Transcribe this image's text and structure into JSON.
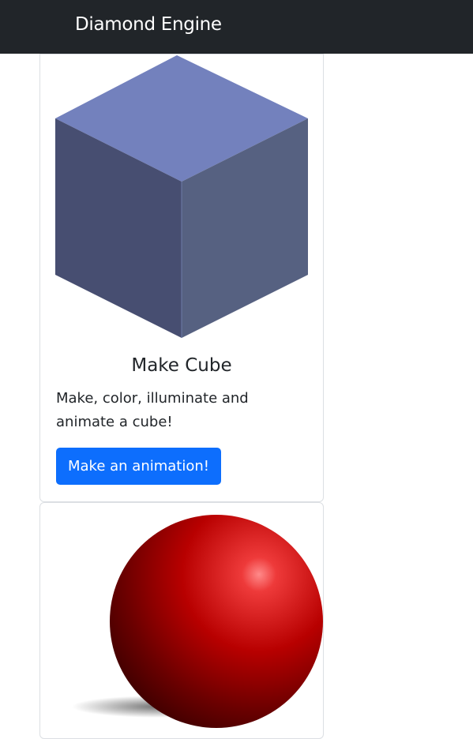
{
  "navbar": {
    "brand": "Diamond Engine",
    "background": "#212529"
  },
  "cards": [
    {
      "image_icon": "cube-icon",
      "title": "Make Cube",
      "text": "Make, color, illuminate and animate a cube!",
      "button_label": "Make an animation!",
      "button_color": "#0d6efd",
      "colors": {
        "top": "#7381bd",
        "left": "#474e71",
        "right": "#566181"
      }
    },
    {
      "image_icon": "sphere-icon",
      "colors": {
        "base": "#b10000",
        "highlight": "#ff6a6a",
        "shadow": "#4a0000"
      }
    }
  ]
}
